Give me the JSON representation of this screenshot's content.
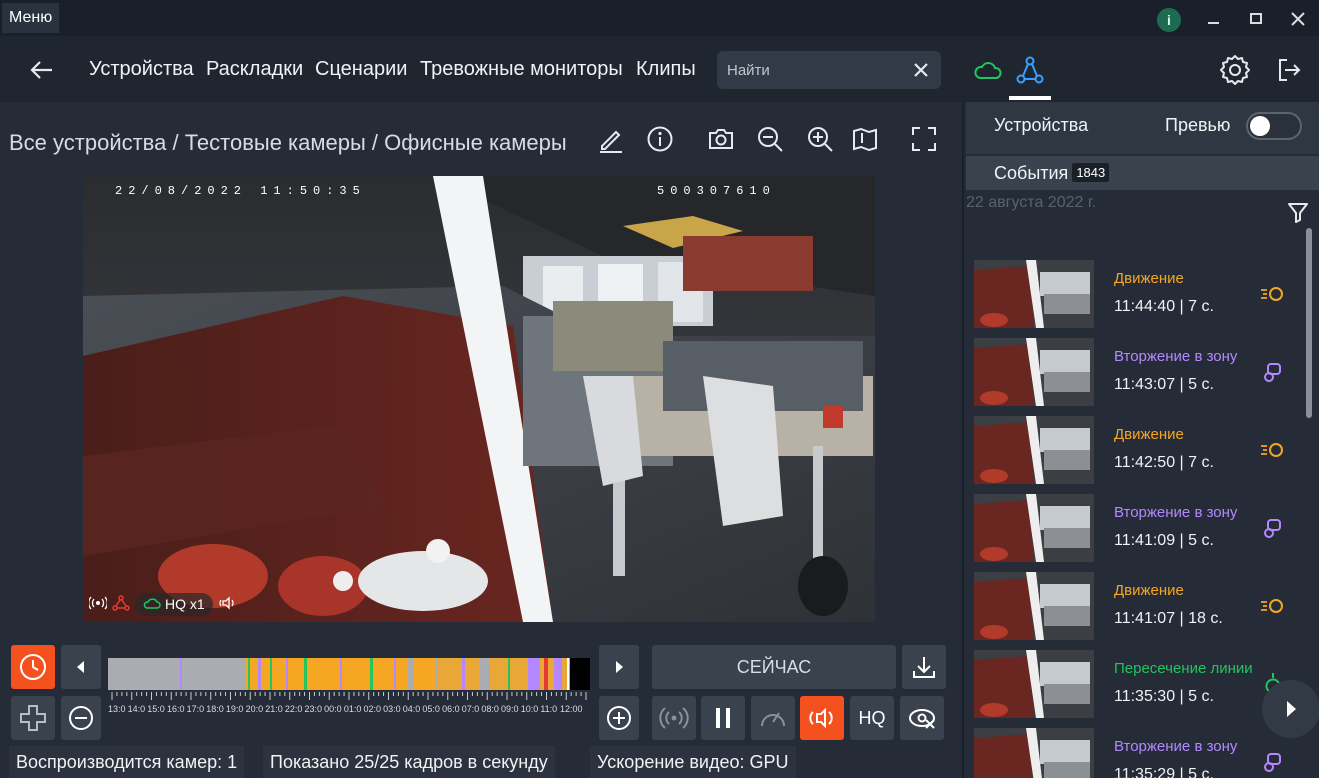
{
  "titlebar": {
    "menu_label": "Меню",
    "info_badge": "i"
  },
  "nav": {
    "items": [
      "Устройства",
      "Раскладки",
      "Сценарии",
      "Тревожные мониторы",
      "Клипы"
    ],
    "search_placeholder": "Найти"
  },
  "breadcrumb": "Все устройства / Тестовые камеры / Офисные камеры",
  "video": {
    "osd_date": "22/08/2022 11:50:35",
    "osd_id": "500307610",
    "quality_label": "HQ x1"
  },
  "timeline": {
    "ticks": [
      "13:0",
      "14:0",
      "15:0",
      "16:0",
      "17:0",
      "18:0",
      "19:0",
      "20:0",
      "21:0",
      "22:0",
      "23:0",
      "00:0",
      "01:0",
      "02:0",
      "03:0",
      "04:0",
      "05:0",
      "06:0",
      "07:0",
      "08:0",
      "09:0",
      "10:0",
      "11:0",
      "12:00"
    ],
    "now_label": "СЕЙЧАС",
    "hq_label": "HQ"
  },
  "status": {
    "cameras": "Воспроизводится камер: 1",
    "fps": "Показано 25/25 кадров в секунду",
    "accel": "Ускорение видео: GPU"
  },
  "right_panel": {
    "devices_tab": "Устройства",
    "preview_label": "Превью",
    "events_tab": "События",
    "events_count": "1843",
    "date": "22 августа 2022 г.",
    "events": [
      {
        "type": "Движение",
        "time": "11:44:40  |  7 с.",
        "kind": "motion"
      },
      {
        "type": "Вторжение в зону",
        "time": "11:43:07  |  5 с.",
        "kind": "zone"
      },
      {
        "type": "Движение",
        "time": "11:42:50  |  7 с.",
        "kind": "motion"
      },
      {
        "type": "Вторжение в зону",
        "time": "11:41:09  |  5 с.",
        "kind": "zone"
      },
      {
        "type": "Движение",
        "time": "11:41:07  |  18 с.",
        "kind": "motion"
      },
      {
        "type": "Пересечение линии",
        "time": "11:35:30  |  5 с.",
        "kind": "line"
      },
      {
        "type": "Вторжение в зону",
        "time": "11:35:29  |  5 с.",
        "kind": "zone"
      }
    ]
  },
  "colors": {
    "accent_orange": "#f4511e",
    "motion": "#f5a623",
    "zone": "#b388ff",
    "line": "#22c55e",
    "cloud": "#22c55e",
    "network": "#3aa0ff"
  }
}
